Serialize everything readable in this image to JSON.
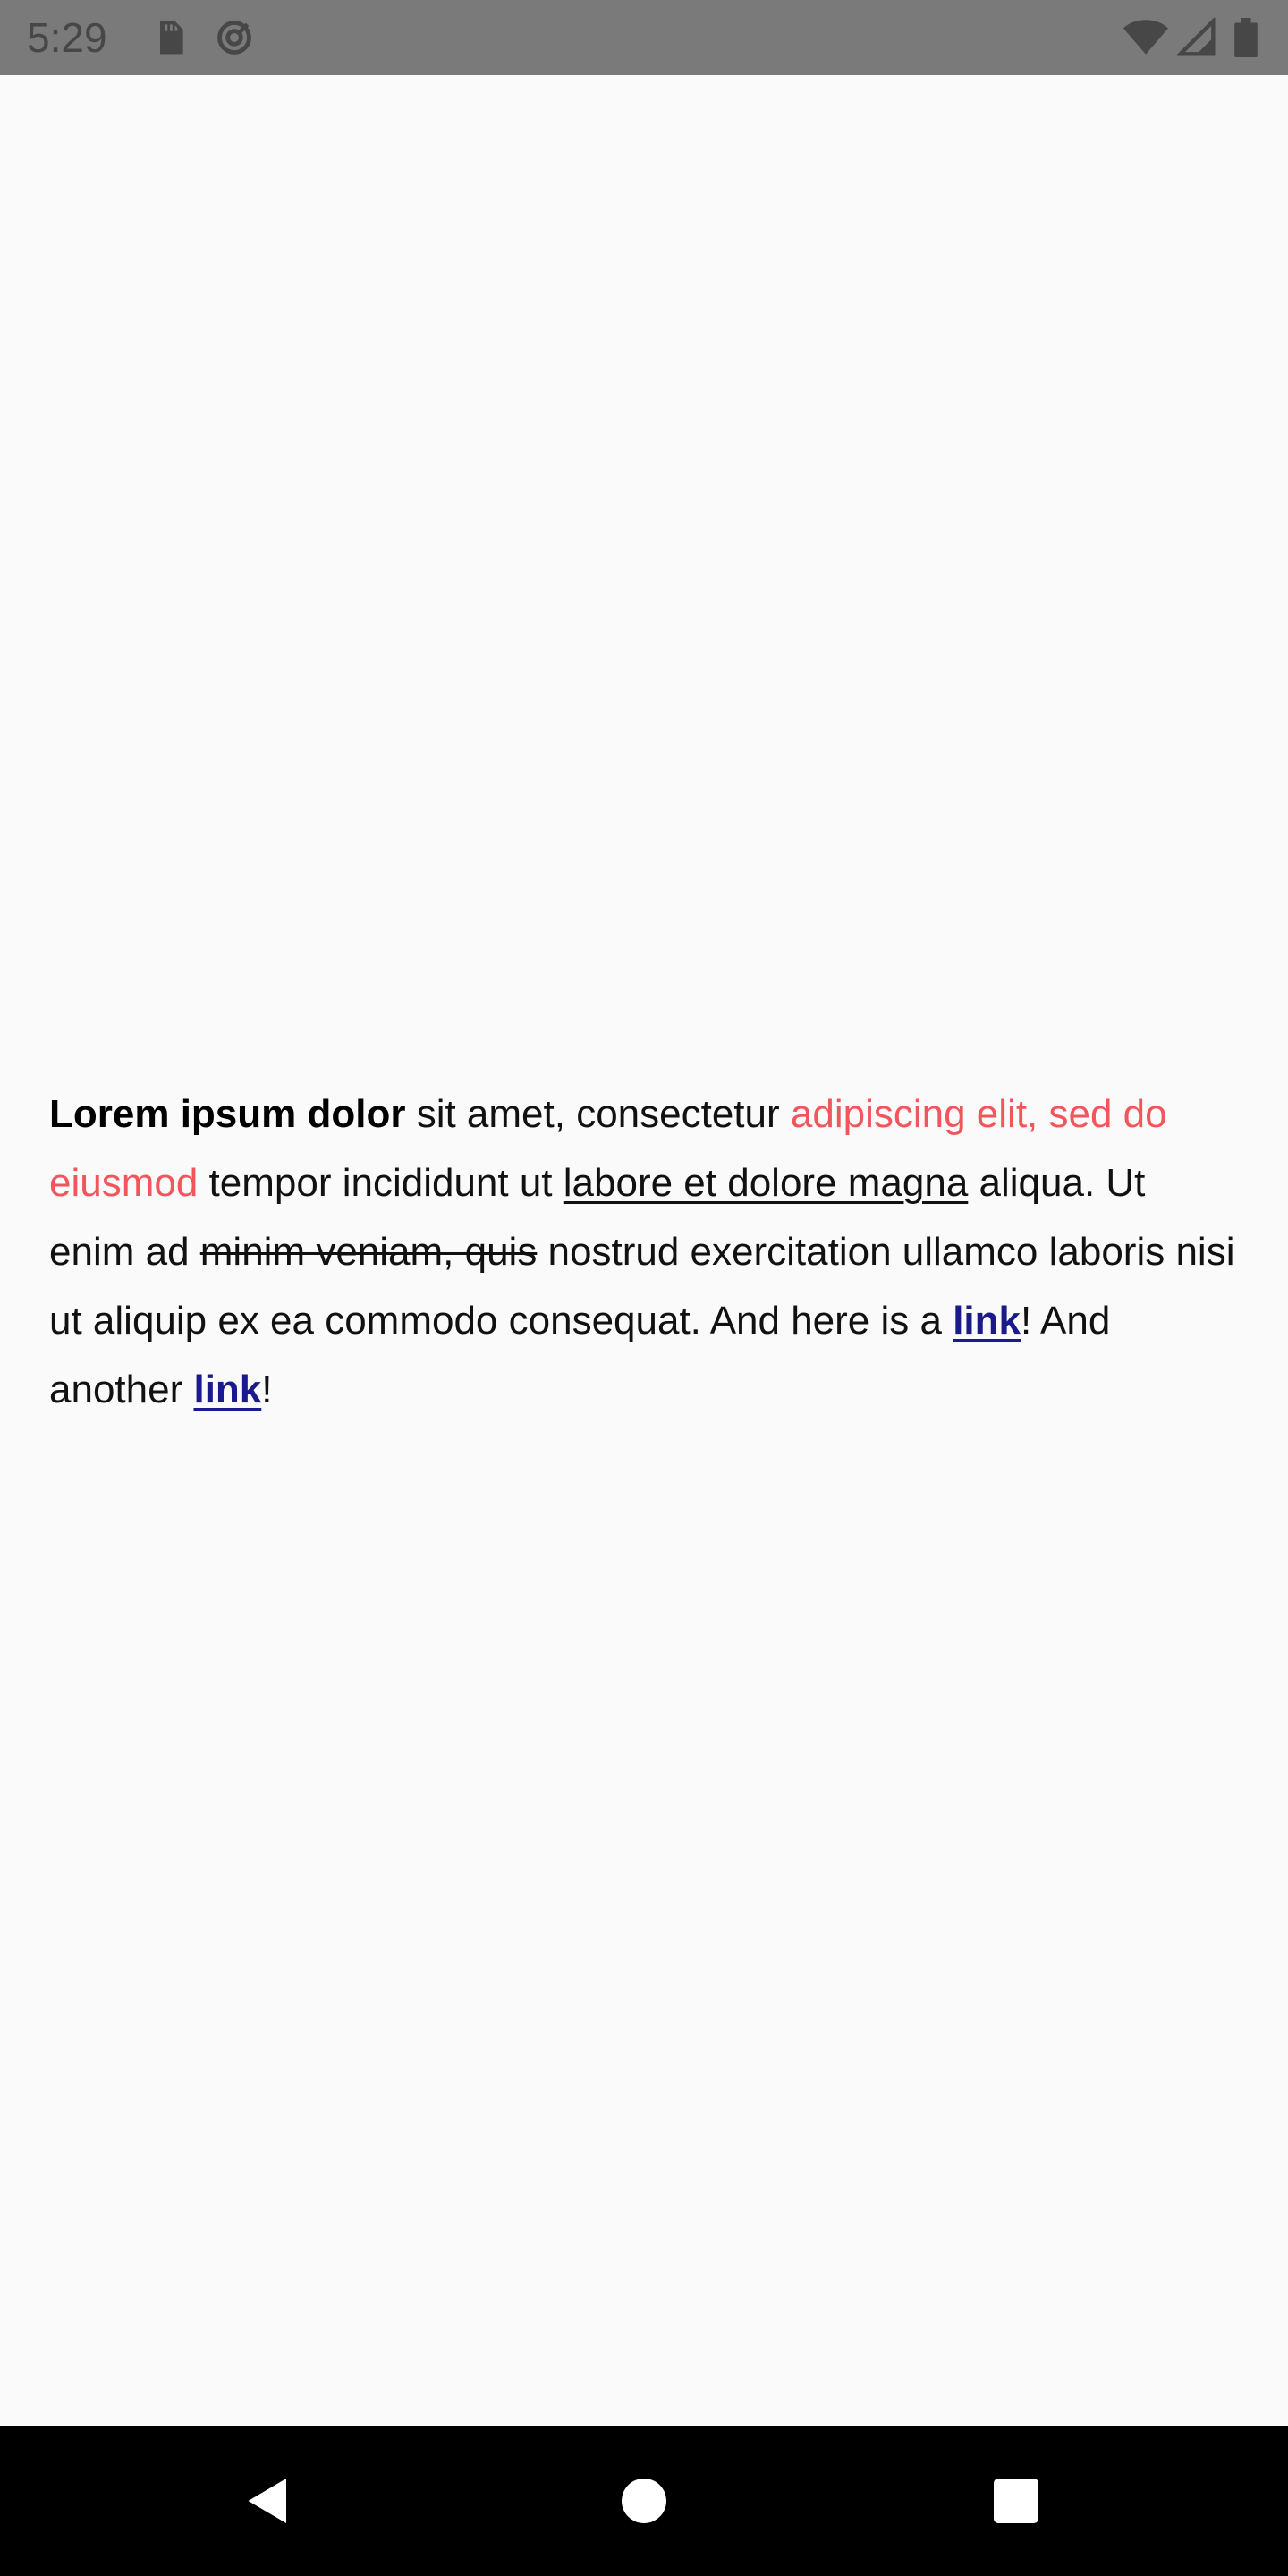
{
  "status_bar": {
    "time": "5:29",
    "icons": [
      "sd-card-icon",
      "sync-icon",
      "wifi-icon",
      "signal-icon",
      "battery-icon"
    ]
  },
  "content": {
    "bold_text": "Lorem ipsum dolor",
    "text_1": " sit amet, consectetur ",
    "red_text": "adipiscing elit, sed do eiusmod",
    "text_2": " tempor incididunt ut ",
    "underline_text": "labore et dolore magna",
    "text_3": " aliqua. Ut enim ad ",
    "strike_text": "minim veniam, quis",
    "text_4": " nostrud exercitation ullamco laboris nisi ut aliquip ex ea commodo consequat. And here is a ",
    "link_1": "link",
    "text_5": "! And another ",
    "link_2": "link",
    "text_6": "!"
  },
  "colors": {
    "background": "#fafafa",
    "status_bar": "#7a7a7a",
    "red_text": "#f0565c",
    "link": "#1a1a8a",
    "nav_bar": "#000000"
  },
  "nav_bar": {
    "buttons": [
      "back-icon",
      "home-icon",
      "recents-icon"
    ]
  }
}
